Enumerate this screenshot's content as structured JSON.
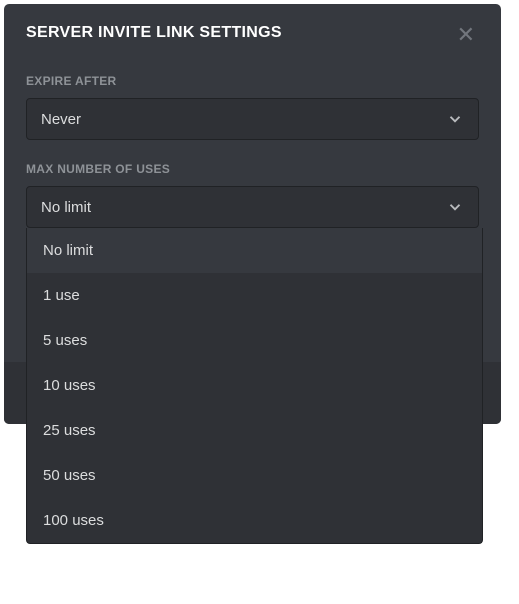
{
  "modal": {
    "title": "SERVER INVITE LINK SETTINGS"
  },
  "expire": {
    "label": "EXPIRE AFTER",
    "value": "Never"
  },
  "maxUses": {
    "label": "MAX NUMBER OF USES",
    "value": "No limit",
    "options": [
      "No limit",
      "1 use",
      "5 uses",
      "10 uses",
      "25 uses",
      "50 uses",
      "100 uses"
    ]
  }
}
